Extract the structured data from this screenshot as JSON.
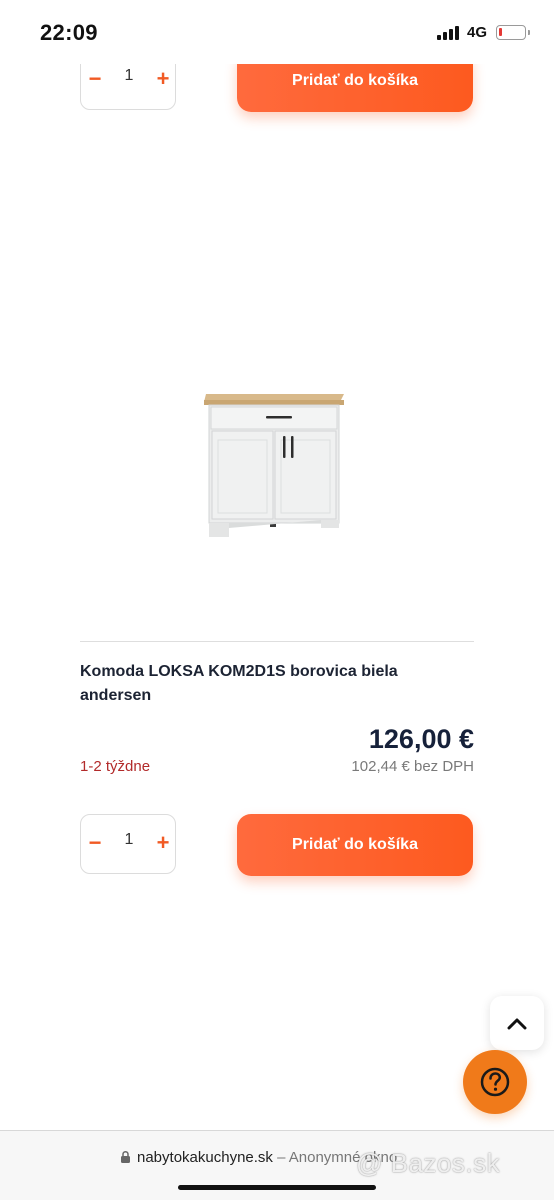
{
  "status_bar": {
    "time": "22:09",
    "network": "4G",
    "battery_color": "#e53935"
  },
  "top_item": {
    "quantity": "1",
    "minus_label": "−",
    "plus_label": "+",
    "add_to_cart_label": "Pridať do košíka"
  },
  "product": {
    "image_icon": "cabinet-image",
    "title": "Komoda LOKSA KOM2D1S borovica biela andersen",
    "availability": "1-2 týždne",
    "price": "126,00 €",
    "price_net": "102,44 € bez DPH",
    "quantity": "1",
    "minus_label": "−",
    "plus_label": "+",
    "add_to_cart_label": "Pridať do košíka"
  },
  "floating": {
    "scroll_top_icon": "chevron-up-icon",
    "help_icon": "question-icon",
    "help_color": "#f07a1a"
  },
  "browser": {
    "domain": "nabytokakuchyne.sk",
    "mode": " – Anonymné okno"
  },
  "watermark": "@ Bazos.sk",
  "colors": {
    "accent": "#fd5a1f",
    "availability": "#b22a2a",
    "price": "#16213a"
  }
}
